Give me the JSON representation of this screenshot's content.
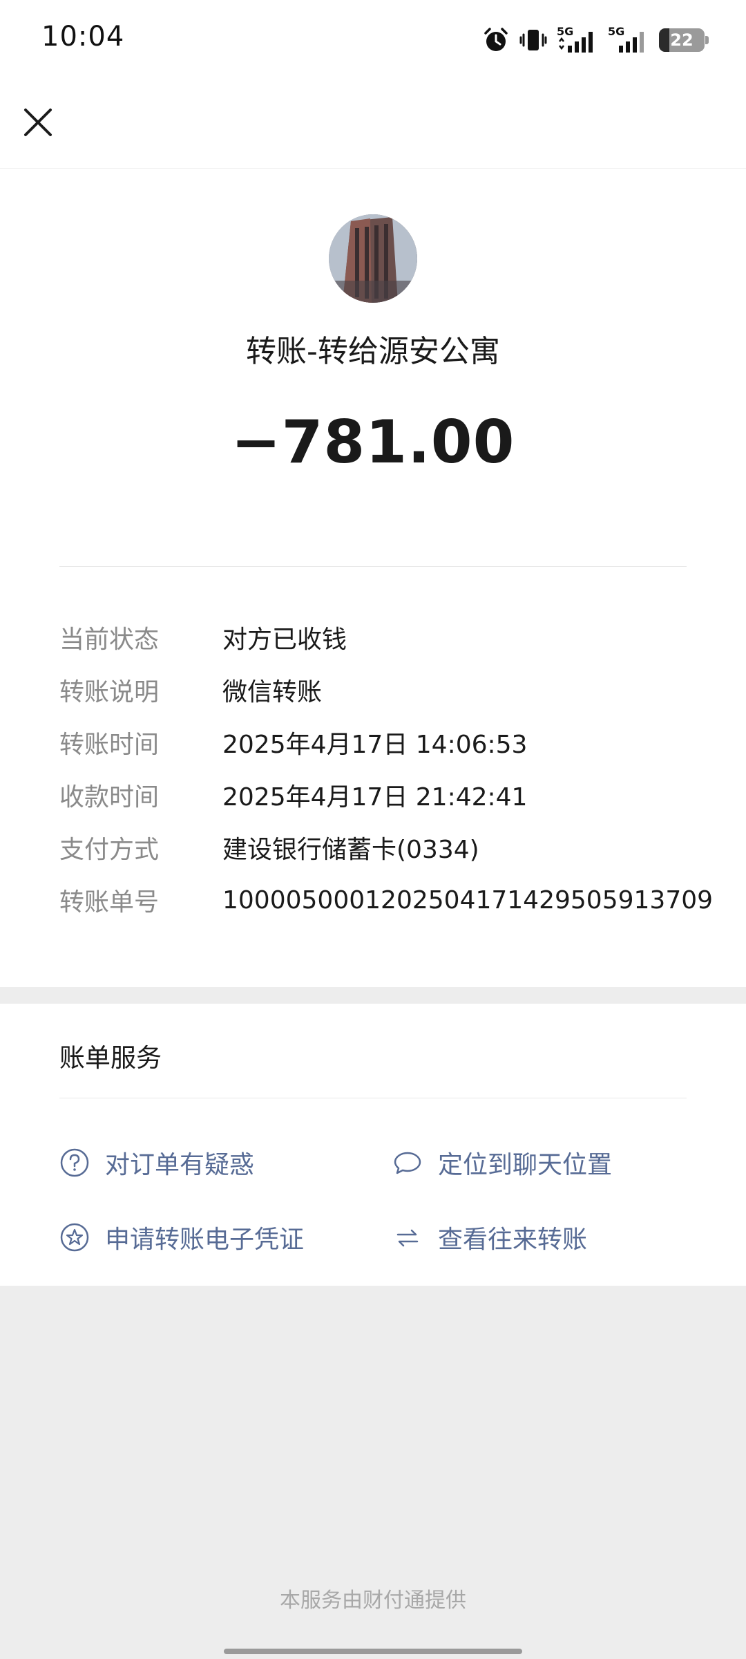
{
  "status_bar": {
    "time": "10:04",
    "icons": [
      "alarm-icon",
      "vibrate-icon",
      "signal-5g-icon",
      "signal-5g-icon"
    ],
    "network_1": "5G",
    "network_2": "5G",
    "battery": "22"
  },
  "nav": {
    "close_icon": "close-icon"
  },
  "transfer": {
    "title": "转账-转给源安公寓",
    "amount": "−781.00"
  },
  "details": [
    {
      "label": "当前状态",
      "value": "对方已收钱"
    },
    {
      "label": "转账说明",
      "value": "微信转账"
    },
    {
      "label": "转账时间",
      "value": "2025年4月17日 14:06:53"
    },
    {
      "label": "收款时间",
      "value": "2025年4月17日 21:42:41"
    },
    {
      "label": "支付方式",
      "value": "建设银行储蓄卡(0334)"
    },
    {
      "label": "转账单号",
      "value": "100005000120250417142950591370​9"
    }
  ],
  "services": {
    "title": "账单服务",
    "items": [
      {
        "label": "对订单有疑惑",
        "icon": "question-circle-icon"
      },
      {
        "label": "定位到聊天位置",
        "icon": "chat-bubble-icon"
      },
      {
        "label": "申请转账电子凭证",
        "icon": "star-circle-icon"
      },
      {
        "label": "查看往来转账",
        "icon": "exchange-arrows-icon"
      }
    ]
  },
  "footer": "本服务由财付通提供",
  "colors": {
    "link": "#576b95",
    "label": "#8a8a8a",
    "background": "#ededed"
  }
}
